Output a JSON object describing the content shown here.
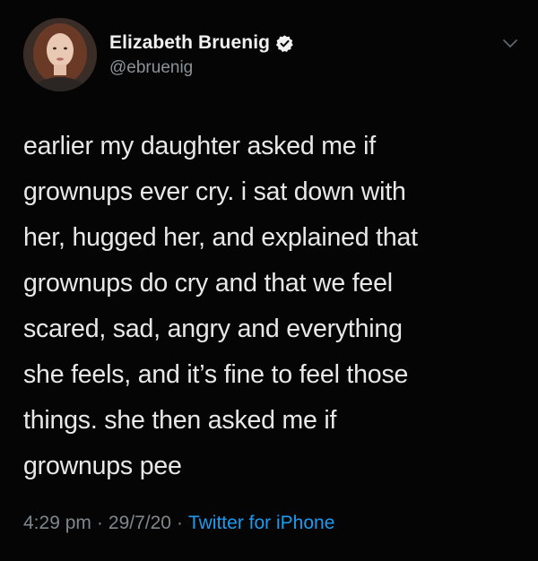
{
  "tweet": {
    "display_name": "Elizabeth Bruenig",
    "handle": "@ebruenig",
    "text": "earlier my daughter asked me if\ngrownups ever cry. i sat down with\nher, hugged her, and explained that\ngrownups do cry and that we feel\nscared, sad, angry and everything\nshe feels, and it’s fine to feel those\nthings. she then asked me if\ngrownups pee",
    "time": "4:29 pm",
    "date": "29/7/20",
    "source": "Twitter for iPhone",
    "separator": "·"
  },
  "icons": {
    "verified": "verified-badge-icon",
    "menu": "chevron-down-icon"
  },
  "colors": {
    "background": "#050505",
    "text": "#e8e8e8",
    "muted": "#7f878d",
    "link": "#1d9bf0"
  }
}
